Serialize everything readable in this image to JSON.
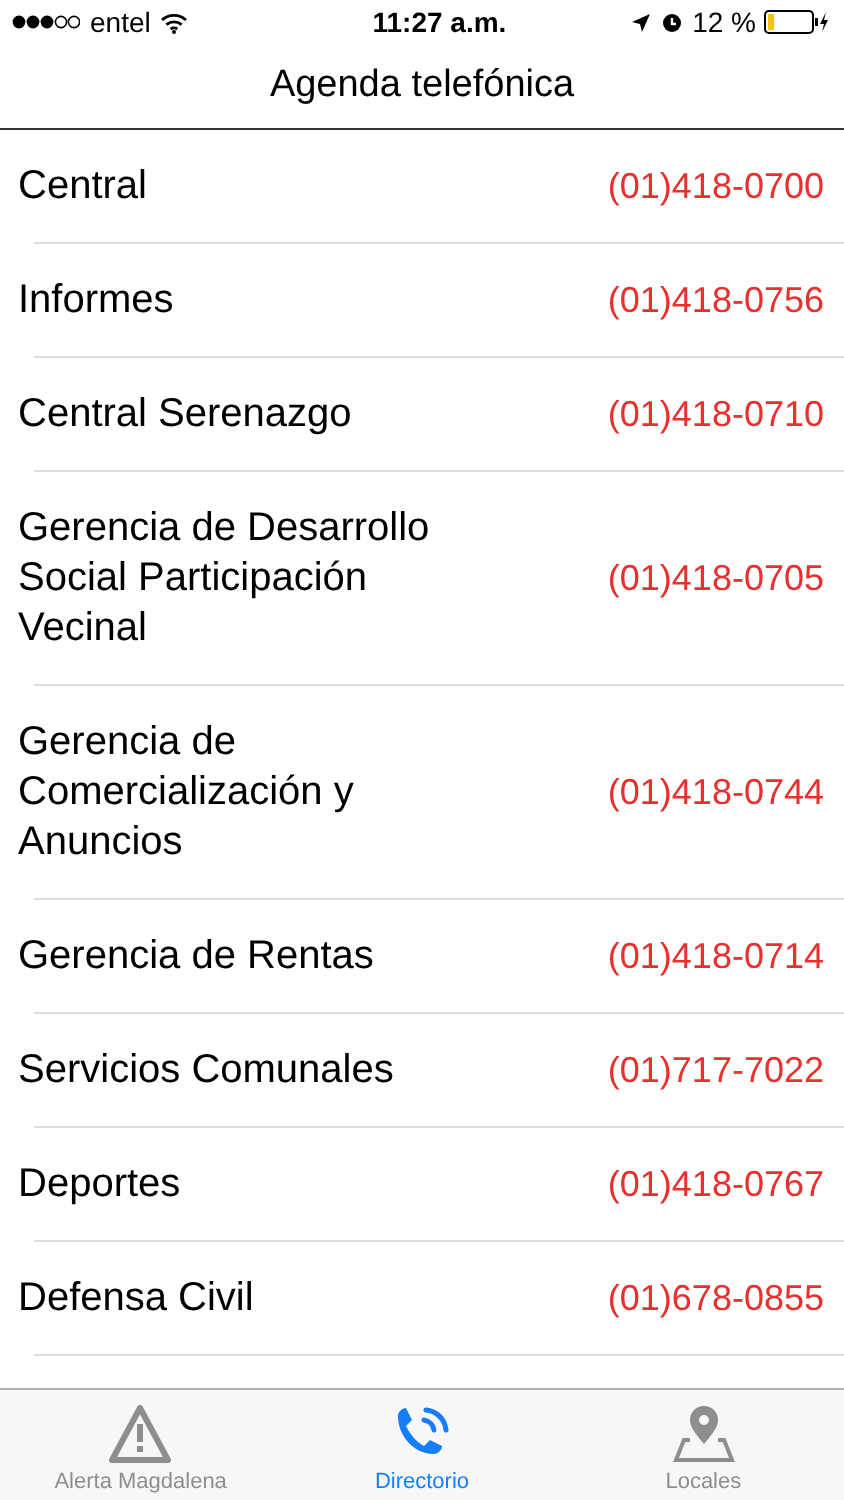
{
  "status_bar": {
    "carrier": "entel",
    "time": "11:27 a.m.",
    "battery_percent": "12 %"
  },
  "nav": {
    "title": "Agenda telefónica"
  },
  "contacts": [
    {
      "name": "Central",
      "phone": "(01)418-0700"
    },
    {
      "name": "Informes",
      "phone": "(01)418-0756"
    },
    {
      "name": "Central Serenazgo",
      "phone": "(01)418-0710"
    },
    {
      "name": "Gerencia de Desarrollo Social Participación Vecinal",
      "phone": "(01)418-0705"
    },
    {
      "name": "Gerencia de Comercialización y Anuncios",
      "phone": "(01)418-0744"
    },
    {
      "name": "Gerencia de Rentas",
      "phone": "(01)418-0714"
    },
    {
      "name": "Servicios Comunales",
      "phone": "(01)717-7022"
    },
    {
      "name": "Deportes",
      "phone": "(01)418-0767"
    },
    {
      "name": "Defensa Civil",
      "phone": "(01)678-0855"
    }
  ],
  "tab_bar": [
    {
      "kind": "alert",
      "label": "Alerta Magdalena",
      "selected": false
    },
    {
      "kind": "phone",
      "label": "Directorio",
      "selected": true
    },
    {
      "kind": "map",
      "label": "Locales",
      "selected": false
    }
  ]
}
